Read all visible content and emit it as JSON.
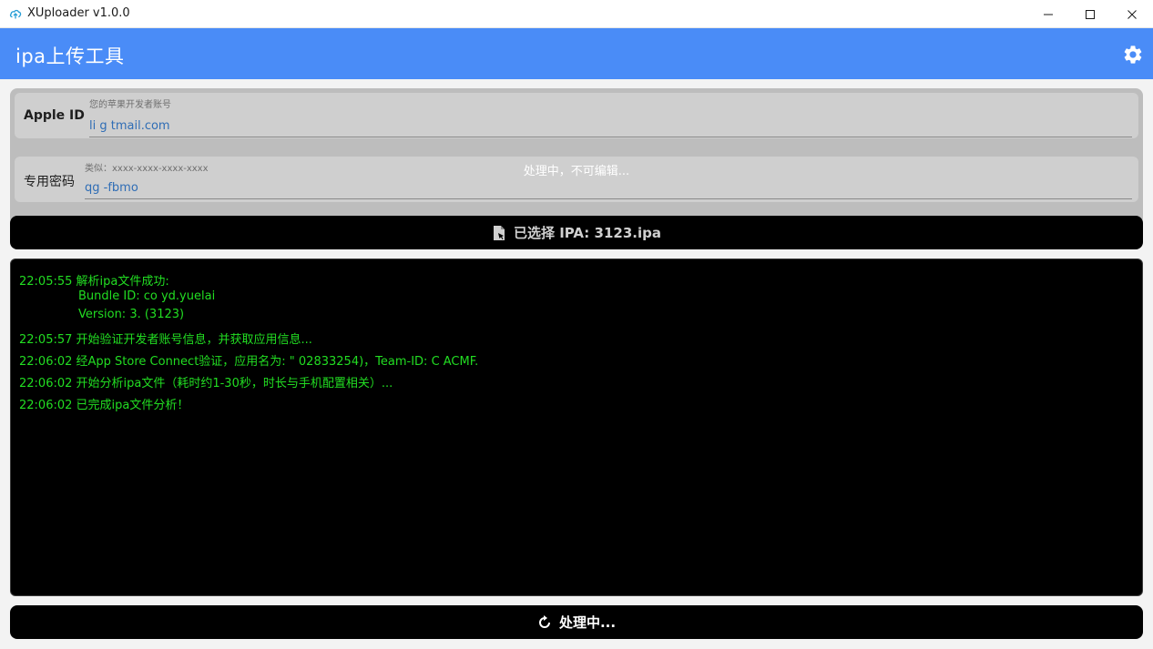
{
  "window": {
    "title": "XUploader v1.0.0"
  },
  "header": {
    "title": "ipa上传工具",
    "settings_icon": "gear-icon"
  },
  "form": {
    "apple_id": {
      "label": "Apple ID",
      "hint": "您的苹果开发者账号",
      "value": "li      g               tmail.com"
    },
    "password": {
      "label": "专用密码",
      "hint": "类似：xxxx-xxxx-xxxx-xxxx",
      "value": "qg                      -fbmo"
    },
    "overlay_message": "处理中，不可编辑..."
  },
  "ipa": {
    "label": "已选择 IPA: 3123.ipa",
    "icon": "file-icon"
  },
  "log": [
    "22:05:55 解析ipa文件成功:",
    "Bundle ID: co        yd.yuelai",
    "Version: 3.      (3123)",
    "22:05:57 开始验证开发者账号信息，并获取应用信息...",
    "22:06:02 经App Store Connect验证，应用名为: \"             02833254)，Team-ID: C           ACMF.",
    "22:06:02 开始分析ipa文件（耗时约1-30秒，时长与手机配置相关）...",
    "22:06:02 已完成ipa文件分析！"
  ],
  "process_button": {
    "label": "处理中...",
    "icon": "refresh-icon"
  },
  "colors": {
    "accent": "#4a8cf7",
    "log_text": "#22dd22",
    "console_bg": "#000000"
  }
}
